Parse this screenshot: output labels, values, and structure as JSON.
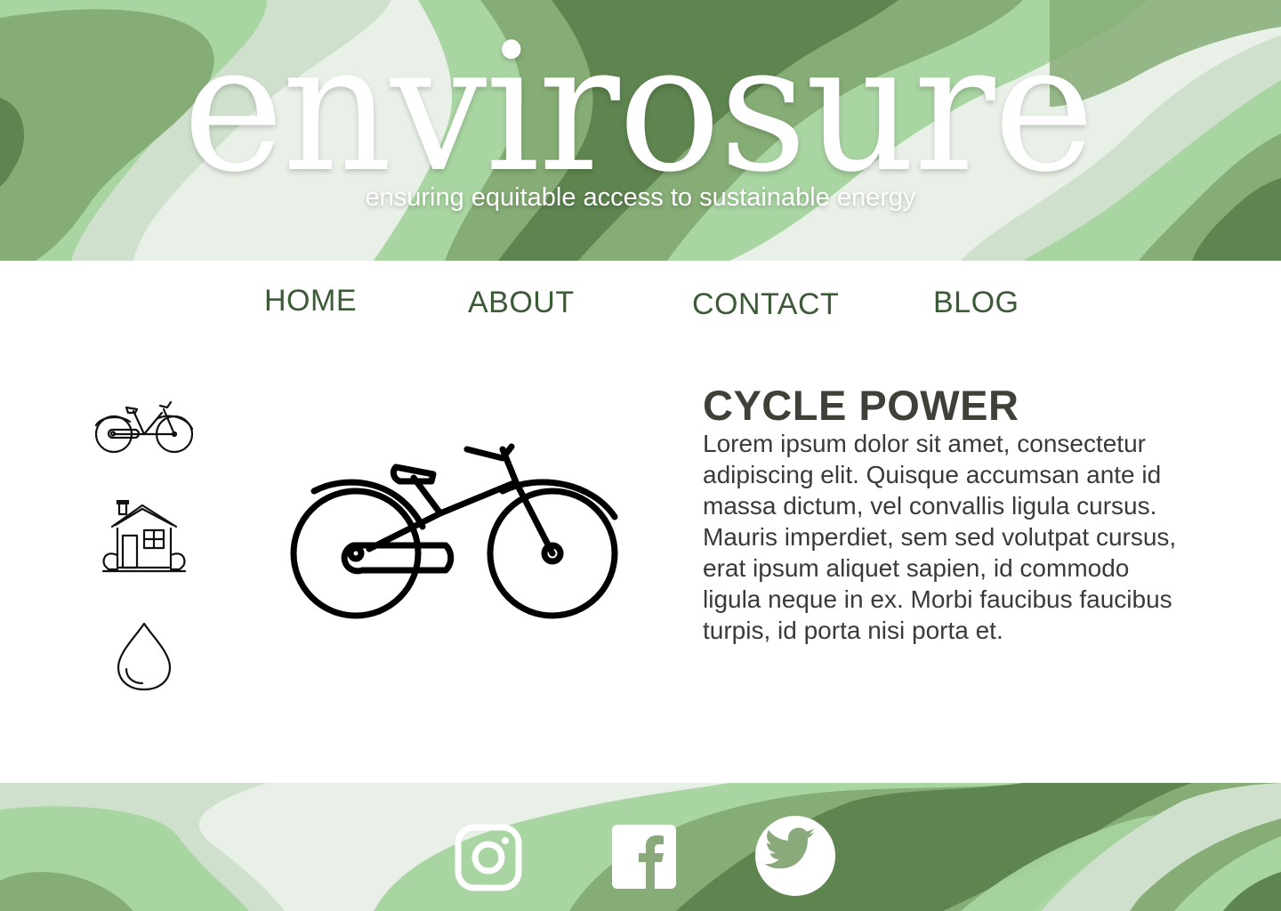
{
  "brand": {
    "logo": "envirosure",
    "tagline": "ensuring equitable access to sustainable energy"
  },
  "nav": {
    "items": [
      "HOME",
      "ABOUT",
      "CONTACT",
      "BLOG"
    ]
  },
  "sidebar": {
    "icons": [
      "bicycle-icon",
      "house-icon",
      "water-drop-icon"
    ]
  },
  "main": {
    "image": "bicycle-icon",
    "title": "CYCLE POWER",
    "body": "Lorem ipsum dolor sit amet, consectetur adipiscing elit. Quisque accumsan ante id massa dictum, vel convallis ligula cursus. Mauris imperdiet, sem sed volutpat cursus, erat ipsum aliquet sapien, id commodo ligula neque in ex. Morbi faucibus faucibus turpis, id porta nisi porta et."
  },
  "footer": {
    "social": [
      "instagram-icon",
      "facebook-icon",
      "twitter-icon"
    ]
  },
  "colors": {
    "nav_text": "#3b5a36",
    "title_text": "#3d4138",
    "green_dark": "#5e844f",
    "green_mid": "#86ad75",
    "green_light": "#a9d5a2",
    "green_pale": "#cfe1cc",
    "green_white": "#e8f0e7"
  }
}
